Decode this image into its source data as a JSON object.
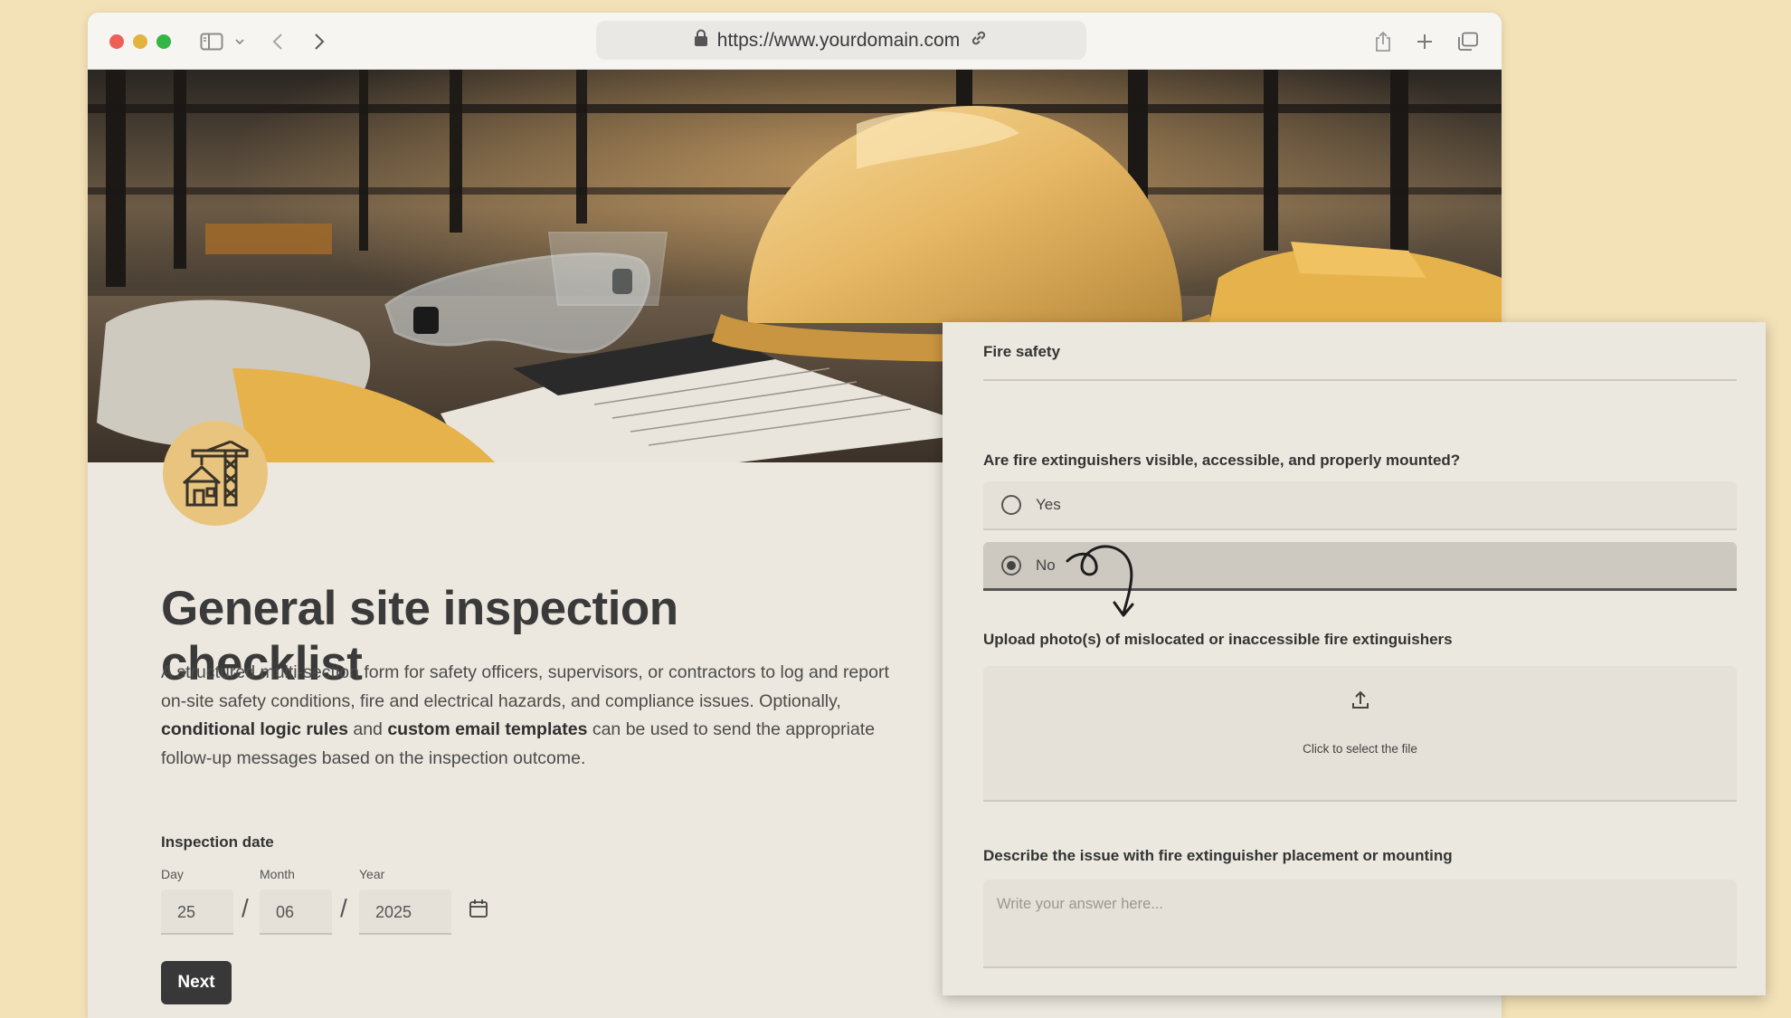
{
  "browser": {
    "url": "https://www.yourdomain.com"
  },
  "form": {
    "title": "General site inspection checklist",
    "description": {
      "part1": "A structured multi-section form for safety officers, supervisors, or contractors to log and report on-site safety conditions, fire and electrical hazards, and compliance issues. Optionally, ",
      "bold1": "conditional logic rules",
      "part2": " and ",
      "bold2": "custom email templates",
      "part3": " can be used to send the appropriate follow-up messages based on the inspection outcome."
    },
    "inspection_date": {
      "label": "Inspection date",
      "day_label": "Day",
      "month_label": "Month",
      "year_label": "Year",
      "day": "25",
      "month": "06",
      "year": "2025",
      "separator": "/"
    },
    "next_label": "Next"
  },
  "panel": {
    "section_title": "Fire safety",
    "question1": "Are fire extinguishers visible, accessible, and properly mounted?",
    "options": [
      {
        "label": "Yes",
        "selected": false
      },
      {
        "label": "No",
        "selected": true
      }
    ],
    "upload_label": "Upload photo(s) of mislocated or inaccessible fire extinguishers",
    "upload_prompt": "Click to select the file",
    "describe_label": "Describe the issue with fire extinguisher placement or mounting",
    "answer_placeholder": "Write your answer here..."
  }
}
